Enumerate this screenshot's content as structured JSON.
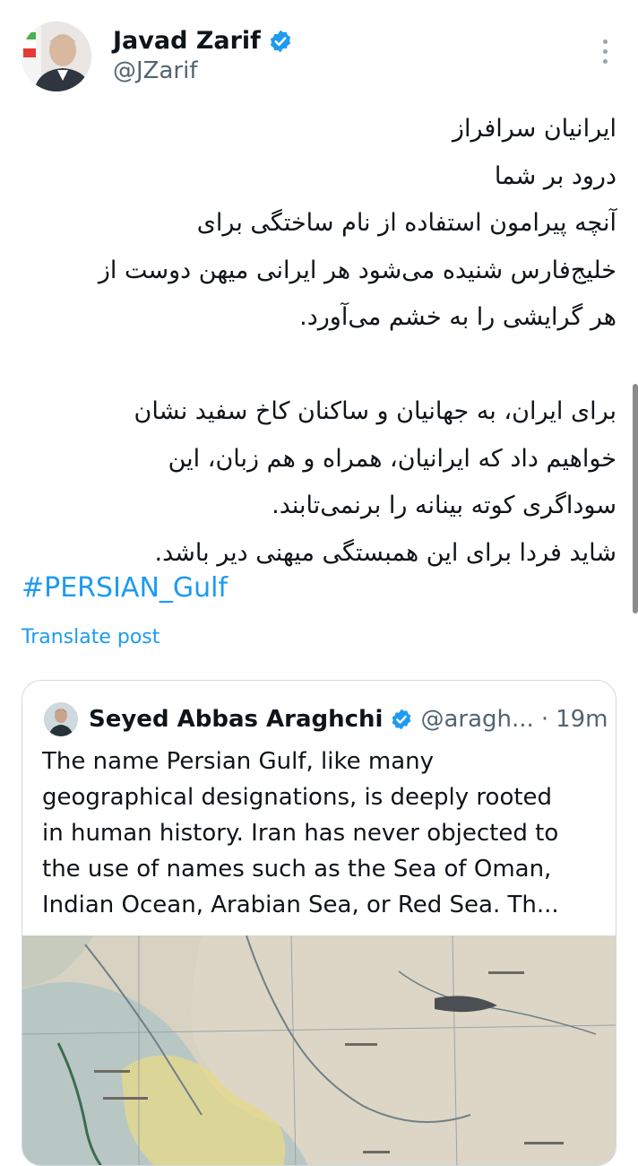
{
  "post": {
    "author_name": "Javad Zarif",
    "author_handle": "@JZarif",
    "lines": [
      "ایرانیان سرافراز",
      "درود بر شما",
      "آنچه پیرامون استفاده از نام ساختگی برای",
      "خلیج‌فارس شنیده می‌شود هر ایرانی میهن دوست از",
      "هر گرایشی را به خشم می‌آورد.",
      "",
      "برای ایران، به جهانیان و ساکنان کاخ سفید نشان",
      "خواهیم داد که ایرانیان، همراه و هم زبان، این",
      "سوداگری کوته بینانه را برنمی‌تابند.",
      "شاید فردا برای این همبستگی میهنی دیر باشد."
    ],
    "hashtag": "#PERSIAN_Gulf",
    "translate_label": "Translate post"
  },
  "quote": {
    "author_name": "Seyed Abbas Araghchi",
    "author_handle": "@aragh...",
    "separator": "·",
    "time": "19m",
    "lines": [
      "The name Persian Gulf, like many",
      "geographical designations, is deeply rooted",
      "in human history. Iran has never objected to",
      "the use of names such as the Sea of Oman,",
      "Indian Ocean, Arabian Sea, or Red Sea. Th..."
    ]
  },
  "icons": {
    "verified": "verified-badge-icon",
    "more": "more-vertical-icon"
  },
  "colors": {
    "link": "#1d9bf0",
    "secondary_text": "#536471",
    "border": "#cfd9de"
  }
}
